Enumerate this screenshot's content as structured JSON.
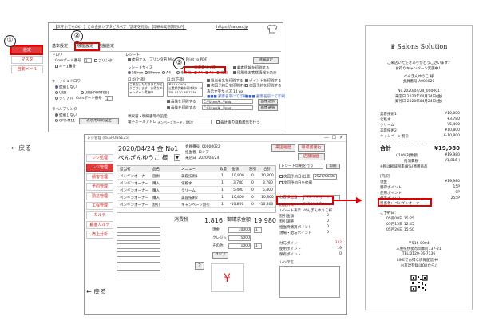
{
  "nav_top": {
    "items": [
      {
        "label": "設定"
      },
      {
        "label": "マスタ"
      },
      {
        "label": "自動メール"
      }
    ],
    "back": "← 戻る"
  },
  "settings_window": {
    "title_bar": "【スマホでもOK！】この会員シプタビスペア「説明を見る」【印刷&実務説明UP】",
    "url": "https://salons.jp",
    "tabs": [
      "基本設定",
      "機能設定",
      "店舗設定"
    ],
    "left_panel": {
      "section_title_1": "ドロワ",
      "com_port_label": "Comポート番号",
      "com_port_value": "1",
      "print_to_label": "プリンタ",
      "pin_label": "キー1番号",
      "section_title_2": "キャッシュドロワ",
      "drawer_use": "使用しない",
      "usb_label": "USB",
      "usb_ports": "USB(PORT00)",
      "serial_label": "シリアル",
      "com_port2_label": "Comポート番号",
      "com_port2_value": "1",
      "section_title_3": "ラベルプリンタ",
      "label_use": "使用しない",
      "label_model": "CPX-M11",
      "label_button": "表示用印刷設定"
    },
    "receipt_panel": {
      "section": "レシート",
      "printer_label": "使用する",
      "printer_name": "プリンタ名  Microsoft Print to PDF",
      "detail_button": "詳細設定",
      "size_label": "レシートサイズ",
      "size_58": "58mm",
      "size_80": "80mm",
      "size_a4": "A4",
      "size_other": "その他",
      "print_label": "領収書サイズ",
      "print_opt1": "A4",
      "print_opt2": "A5",
      "print_opt3": "自動",
      "logo_header": "ロゴ(上部)",
      "logo_footer": "ロゴ(下部)",
      "footer_sample": "〒516-0004\n三重県伊勢市岡本町4-16-8\nTEL.0120-36-7136",
      "opt_a": "顧客情報を印刷する",
      "opt_b": "ポイントを印刷する",
      "opt_c": "印刷後お客様情報を表示",
      "opt_d": "担当者名を印刷する",
      "opt_e": "次回予約日を印刷する",
      "opt_f": "次回予約を印刷する",
      "font_label": "表示文字サイズ",
      "font_value": "14",
      "font_unit": "px",
      "sample_text": "■■■ 顧客名字にて印刷",
      "sample_text2": "■■■ 顧客名前にて印刷",
      "img_label": "画像を印刷する",
      "img_path": "C:¥Users¥...¥png",
      "img_button": "画像選択",
      "img_label2": "画像を印刷する",
      "img_path2": "C:¥Users¥...¥png",
      "img_button2": "画像選択",
      "mail_section": "領収書・明細書等の設定",
      "mail_label": "電子メールアドレス",
      "mail_value": "メンバーズカード、XX次",
      "mail_opt": "会計後の自動送信を行う"
    }
  },
  "pos_window": {
    "title": "レジ管理 (RESPONSE25)",
    "date": "2020/04/24",
    "day": "金",
    "register": "No1",
    "customer_label": "ぺんぎんゆうこ 様",
    "header_fields": [
      {
        "label": "会員番号",
        "value": "00000022"
      },
      {
        "label": "担当者",
        "value": "ロンア"
      },
      {
        "label": "来店日",
        "value": "2020/04/24"
      }
    ],
    "top_buttons": [
      "来店履歴",
      "領収書発行",
      "店舗履歴"
    ],
    "side_nav": [
      {
        "label": "レジ処理"
      },
      {
        "label": "レジ管理"
      },
      {
        "label": "顧客管理"
      },
      {
        "label": "予約管理"
      },
      {
        "label": "勤怠管理"
      },
      {
        "label": "工程管理"
      },
      {
        "label": "カルテ"
      },
      {
        "label": "顧客カルテ"
      },
      {
        "label": "売上分析"
      }
    ],
    "table_headers": [
      "担当者",
      "品名",
      "メニュー",
      "数量",
      "金額",
      "割引",
      "合計"
    ],
    "rows": [
      {
        "staff": "ペンギンオーナー",
        "type": "施術",
        "menu": "美容技術1",
        "qty": "1",
        "price": "10,800",
        "disc": "0",
        "total": "10,800"
      },
      {
        "staff": "ペンギンオーナー",
        "type": "購入",
        "menu": "化粧水",
        "qty": "1",
        "price": "3,780",
        "disc": "0",
        "total": "3,780"
      },
      {
        "staff": "ペンギンオーナー",
        "type": "購入",
        "menu": "クリーム",
        "qty": "1",
        "price": "5,400",
        "disc": "0",
        "total": "5,400"
      },
      {
        "staff": "ペンギンオーナー",
        "type": "購入",
        "menu": "美容技術2",
        "qty": "1",
        "price": "10,800",
        "disc": "0",
        "total": "10,800"
      },
      {
        "staff": "ペンギンオーナー",
        "type": "割引",
        "menu": "キャンペーン割引",
        "qty": "1",
        "price": "-10,800",
        "disc": "0",
        "total": "-10,800"
      }
    ],
    "tax_label": "消費税",
    "tax_value": "1,816",
    "total_label": "御請求金額",
    "total_value": "19,980",
    "pay_fields": [
      {
        "label": "現金",
        "value": "10000"
      },
      {
        "label": "クレジット",
        "value": "5000"
      },
      {
        "label": "その他",
        "value": "1000"
      }
    ],
    "pay_extra": [
      {
        "label": "お預り",
        "value": "1"
      },
      {
        "label": "お釣り",
        "value": "1"
      }
    ],
    "clear_btn": "クリア",
    "yen_symbol": "¥",
    "help_symbol": "?",
    "right_panel": {
      "receipt_setting": "レシート印刷を行う",
      "dropdown_val": "",
      "print_btn": "印刷",
      "next_label": "次回予約日(任意)",
      "next_date": "2020/05/08",
      "repeat_label": "次回予約日を使用",
      "staff_label": "お客様担当",
      "staff_value": "ペンギンオーナー",
      "rows": [
        {
          "label": "お会計日",
          "value": "2020/04/24"
        },
        {
          "label": "レシート表示",
          "value": "ぺんぎんゆうこ様"
        },
        {
          "label": "割引金額",
          "value": "0"
        },
        {
          "label": "割引調整",
          "value": "0"
        },
        {
          "label": "担当時購買ポイント",
          "value": "0"
        },
        {
          "label": "現場・給与ポイント",
          "value": "0"
        }
      ],
      "point_rows": [
        {
          "label": "付与ポイント",
          "value": "332"
        },
        {
          "label": "使用ポイント",
          "value": "19"
        },
        {
          "label": "保有ポイント",
          "value": "0"
        }
      ],
      "memo_label": "レジ伝言"
    }
  },
  "receipt": {
    "logo": "Salons Solution",
    "thanks": "ご来店いただきありがとうございます♪",
    "thanks2": "お得なキャンペーン実施中！",
    "customer": "ぺんぎんゆうこ 様",
    "member_no": "会員番号 A000020",
    "receipt_no": "No.2020/04/24_000001",
    "visit_date": "来店日 2020年04月24日(金)",
    "issue_date": "発行日 2020年04月24日(金)",
    "items": [
      {
        "name": "美容技術1",
        "value": "¥10,800"
      },
      {
        "name": "化粧水",
        "value": "¥3,780"
      },
      {
        "name": "クリーム",
        "value": "¥5,400"
      },
      {
        "name": "美容技術2",
        "value": "¥10,800"
      },
      {
        "name": "キャンペーン割引",
        "value": "¥-10,800"
      }
    ],
    "total_label": "合計",
    "total_value": "¥19,980",
    "tax_rows": [
      {
        "name": "( 10%対象額",
        "value": "¥19,980"
      },
      {
        "name": "内消費税",
        "value": "¥1,816 )"
      }
    ],
    "tax_note": "※税は軽減税率(8%)適用商品",
    "pay_section": "[内訳]",
    "pay_rows": [
      {
        "name": "現金",
        "value": "¥19,980"
      },
      {
        "name": "獲得ポイント",
        "value": "15P"
      },
      {
        "name": "使用ポイント",
        "value": "0P"
      },
      {
        "name": "保有ポイント",
        "value": "255P"
      }
    ],
    "staff_line": "担当者：ペンギンオーナー",
    "next_section": "ご予約日：",
    "next_dates": [
      "05月08日 15:25",
      "05月15日 12:45",
      "05月26日 15:50"
    ],
    "addr1": "〒516-0004",
    "addr2": "三重県伊勢市岡本町137-21",
    "addr3": "TEL:0120-36-7136",
    "addr4": "LINEでお得な情報配信中！",
    "addr5": "お友達登録はQRから♪"
  },
  "annotations": {
    "step1": "①",
    "step2": "②",
    "step3": "③"
  },
  "colors": {
    "accent": "#e33b3b",
    "highlight": "#e00000"
  }
}
